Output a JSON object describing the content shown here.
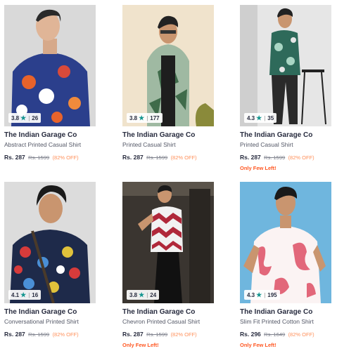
{
  "products": [
    {
      "brand": "The Indian Garage Co",
      "name": "Abstract Printed Casual Shirt",
      "price": "Rs. 287",
      "mrp": "Rs. 1599",
      "discount": "(82% OFF)",
      "rating": "3.8",
      "reviews": "26",
      "few_left": ""
    },
    {
      "brand": "The Indian Garage Co",
      "name": "Printed Casual Shirt",
      "price": "Rs. 287",
      "mrp": "Rs. 1599",
      "discount": "(82% OFF)",
      "rating": "3.8",
      "reviews": "177",
      "few_left": ""
    },
    {
      "brand": "The Indian Garage Co",
      "name": "Printed Casual Shirt",
      "price": "Rs. 287",
      "mrp": "Rs. 1599",
      "discount": "(82% OFF)",
      "rating": "4.3",
      "reviews": "35",
      "few_left": "Only Few Left!"
    },
    {
      "brand": "The Indian Garage Co",
      "name": "Conversational Printed Shirt",
      "price": "Rs. 287",
      "mrp": "Rs. 1599",
      "discount": "(82% OFF)",
      "rating": "4.1",
      "reviews": "16",
      "few_left": ""
    },
    {
      "brand": "The Indian Garage Co",
      "name": "Chevron Printed Casual Shirt",
      "price": "Rs. 287",
      "mrp": "Rs. 1599",
      "discount": "(82% OFF)",
      "rating": "3.8",
      "reviews": "24",
      "few_left": "Only Few Left!"
    },
    {
      "brand": "The Indian Garage Co",
      "name": "Slim Fit Printed Cotton Shirt",
      "price": "Rs. 296",
      "mrp": "Rs. 1649",
      "discount": "(82% OFF)",
      "rating": "4.3",
      "reviews": "195",
      "few_left": "Only Few Left!"
    }
  ],
  "colors": {
    "star": "#14958f",
    "discount": "#ff905a",
    "few_left": "#ff5722"
  }
}
